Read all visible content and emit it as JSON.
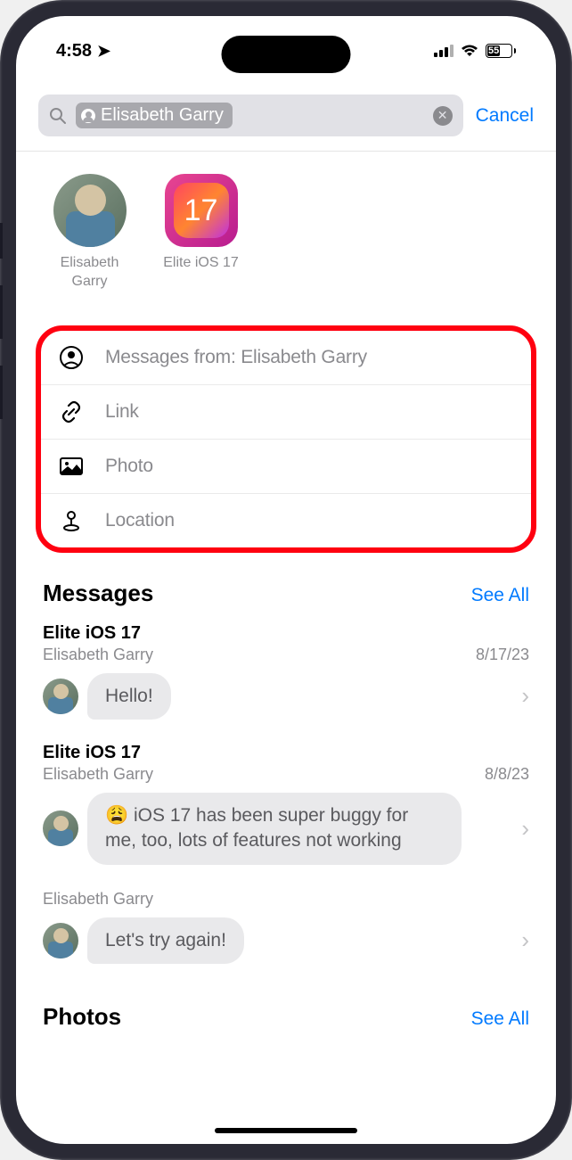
{
  "status": {
    "time": "4:58",
    "battery": "55"
  },
  "search": {
    "query": "Elisabeth Garry",
    "cancel": "Cancel"
  },
  "people": [
    {
      "name": "Elisabeth Garry"
    },
    {
      "name": "Elite iOS 17",
      "badge": "17"
    }
  ],
  "filters": [
    {
      "icon": "person",
      "label": "Messages from: Elisabeth Garry"
    },
    {
      "icon": "link",
      "label": "Link"
    },
    {
      "icon": "photo",
      "label": "Photo"
    },
    {
      "icon": "location",
      "label": "Location"
    }
  ],
  "sections": {
    "messages": {
      "title": "Messages",
      "see_all": "See All"
    },
    "photos": {
      "title": "Photos",
      "see_all": "See All"
    }
  },
  "messages": [
    {
      "thread": "Elite iOS 17",
      "sender": "Elisabeth Garry",
      "date": "8/17/23",
      "text": "Hello!"
    },
    {
      "thread": "Elite iOS 17",
      "sender": "Elisabeth Garry",
      "date": "8/8/23",
      "text": "😩 iOS 17 has been super buggy for me, too, lots of features not working"
    },
    {
      "thread": "",
      "sender": "Elisabeth Garry",
      "date": "",
      "text": "Let's try again!"
    }
  ]
}
